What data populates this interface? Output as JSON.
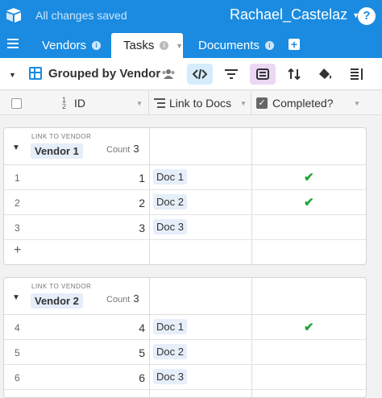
{
  "app": {
    "status": "All changes saved",
    "user": "Rachael_Castelaz",
    "help": "?"
  },
  "tabs": [
    {
      "label": "Vendors"
    },
    {
      "label": "Tasks"
    },
    {
      "label": "Documents"
    }
  ],
  "toolbar": {
    "view_name": "Grouped by Vendor"
  },
  "columns": {
    "id": "ID",
    "link": "Link to Docs",
    "completed": "Completed?"
  },
  "groups": [
    {
      "label": "LINK TO VENDOR",
      "name": "Vendor 1",
      "count_label": "Count",
      "count": "3",
      "rows": [
        {
          "num": "1",
          "id": "1",
          "doc": "Doc 1",
          "completed": true
        },
        {
          "num": "2",
          "id": "2",
          "doc": "Doc 2",
          "completed": true
        },
        {
          "num": "3",
          "id": "3",
          "doc": "Doc 3",
          "completed": false
        }
      ],
      "add": "+"
    },
    {
      "label": "LINK TO VENDOR",
      "name": "Vendor 2",
      "count_label": "Count",
      "count": "3",
      "rows": [
        {
          "num": "4",
          "id": "4",
          "doc": "Doc 1",
          "completed": true
        },
        {
          "num": "5",
          "id": "5",
          "doc": "Doc 2",
          "completed": false
        },
        {
          "num": "6",
          "id": "6",
          "doc": "Doc 3",
          "completed": false
        }
      ]
    }
  ],
  "colors": {
    "brand": "#1a8be0",
    "check": "#22a33a"
  }
}
